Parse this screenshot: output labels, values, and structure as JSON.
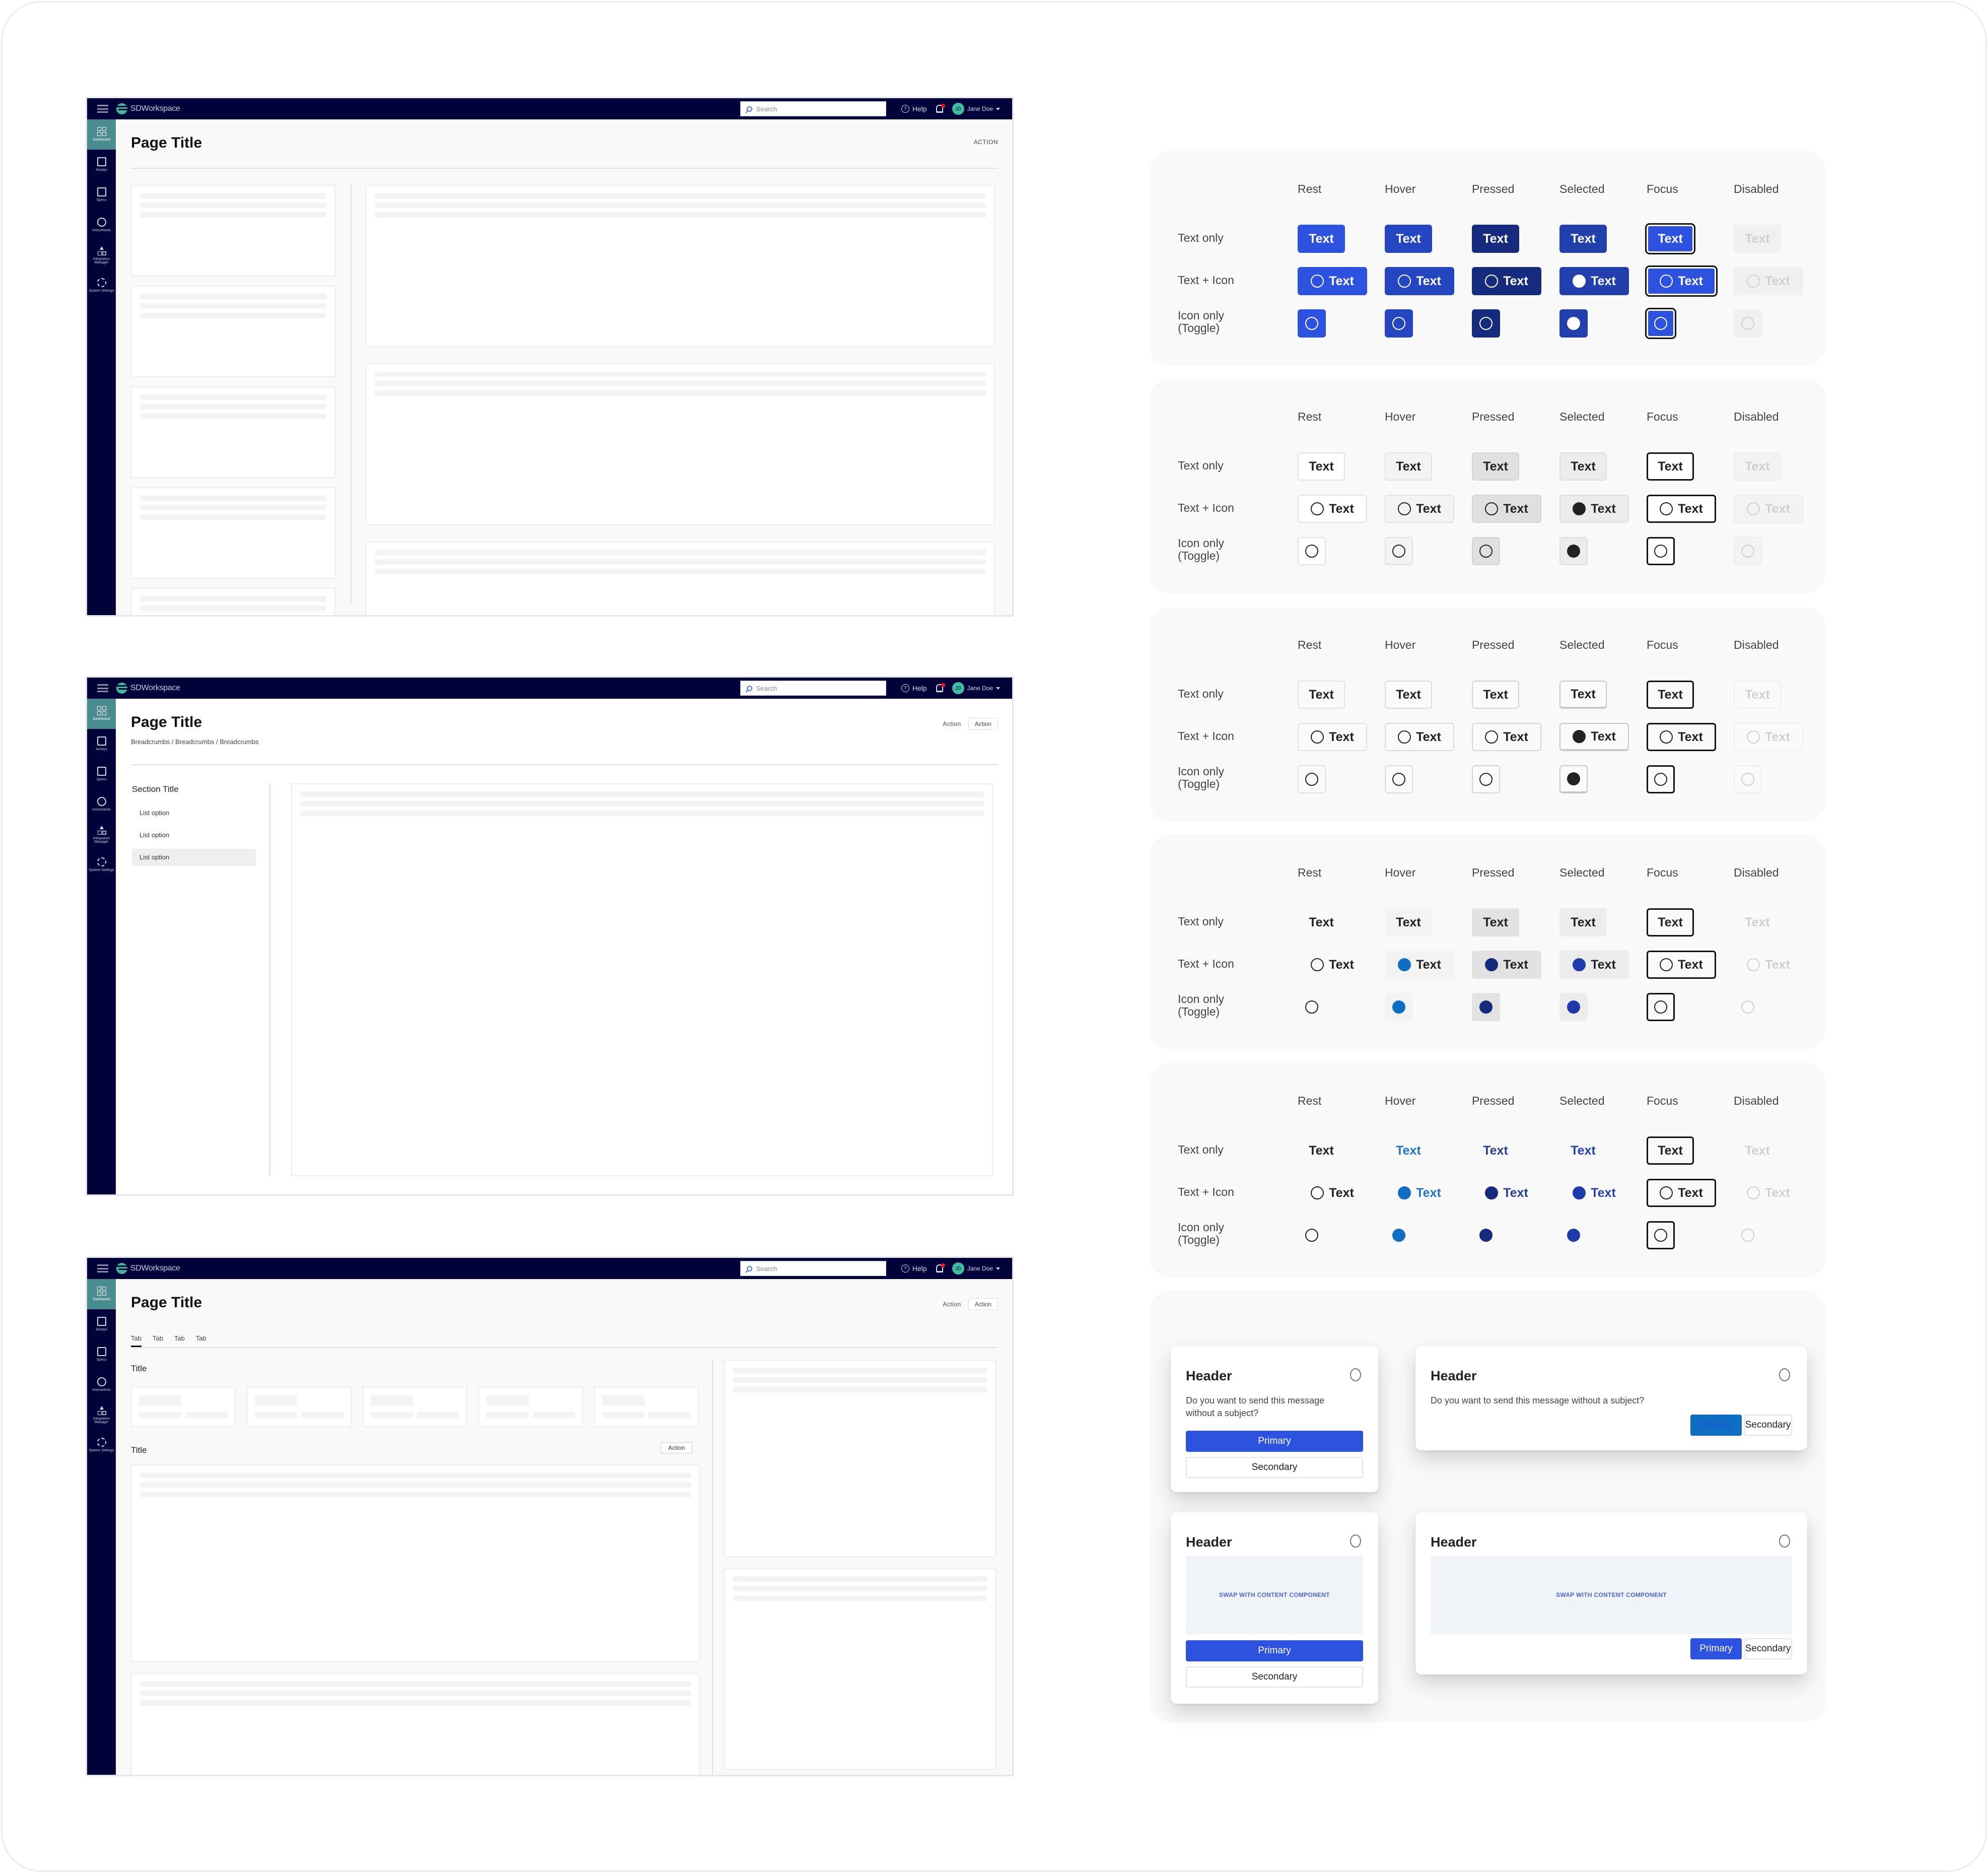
{
  "app": {
    "brand": "SDWorkspace",
    "search_placeholder": "Search",
    "help_label": "Help",
    "user_initials": "JD",
    "user_name": "Jane Doe",
    "nav": [
      {
        "label": "Dashboard",
        "icon": "dashboard-icon",
        "active": true
      },
      {
        "label": "Assays",
        "icon": "assays-icon"
      },
      {
        "label": "Specs",
        "icon": "specs-icon"
      },
      {
        "label": "Instruments",
        "icon": "instruments-icon"
      },
      {
        "label": "Integration Manager",
        "icon": "integration-icon"
      },
      {
        "label": "System Settings",
        "icon": "gear-icon"
      }
    ]
  },
  "mockup1": {
    "page_title": "Page Title",
    "action_label": "ACTION"
  },
  "mockup2": {
    "page_title": "Page Title",
    "breadcrumb": "Breadcrumbs / Breadcrumbs / Breadcrumbs",
    "action_ghost": "Action",
    "action_outlined": "Action",
    "section_title": "Section Title",
    "list_options": [
      "List option",
      "List option",
      "List option"
    ],
    "selected_index": 2
  },
  "mockup3": {
    "page_title": "Page Title",
    "action_ghost": "Action",
    "action_outlined": "Action",
    "tabs": [
      "Tab",
      "Tab",
      "Tab",
      "Tab"
    ],
    "active_tab": 0,
    "section1_title": "Title",
    "section2_title": "Title",
    "section2_action": "Action"
  },
  "matrix": {
    "states": [
      "Rest",
      "Hover",
      "Pressed",
      "Selected",
      "Focus",
      "Disabled"
    ],
    "rows": [
      "Text only",
      "Text + Icon",
      "Icon only (Toggle)"
    ],
    "row3_line1": "Icon only",
    "row3_line2": "(Toggle)",
    "button_label": "Text",
    "variants": [
      "primary",
      "secondary",
      "outline",
      "ghost",
      "link"
    ],
    "colors": {
      "primary_rest": "#2d52e0",
      "primary_hover": "#2446c0",
      "primary_pressed": "#172b7e",
      "primary_selected": "#2140ab",
      "ghost_hover_icon": "#0f6ec4",
      "focus_ring": "#111111",
      "disabled_text": "#d0d0d0"
    }
  },
  "dialogs": [
    {
      "header": "Header",
      "message": "Do you want to send this message without a subject?",
      "primary": "Primary",
      "secondary": "Secondary",
      "layout": "narrow"
    },
    {
      "header": "Header",
      "message": "Do you want to send this message without a subject?",
      "primary": "Primary",
      "secondary": "Secondary",
      "layout": "wide"
    },
    {
      "header": "Header",
      "slot": "SWAP WITH CONTENT COMPONENT",
      "primary": "Primary",
      "secondary": "Secondary",
      "layout": "narrow"
    },
    {
      "header": "Header",
      "slot": "SWAP WITH CONTENT COMPONENT",
      "primary": "Primary",
      "secondary": "Secondary",
      "layout": "wide"
    }
  ]
}
